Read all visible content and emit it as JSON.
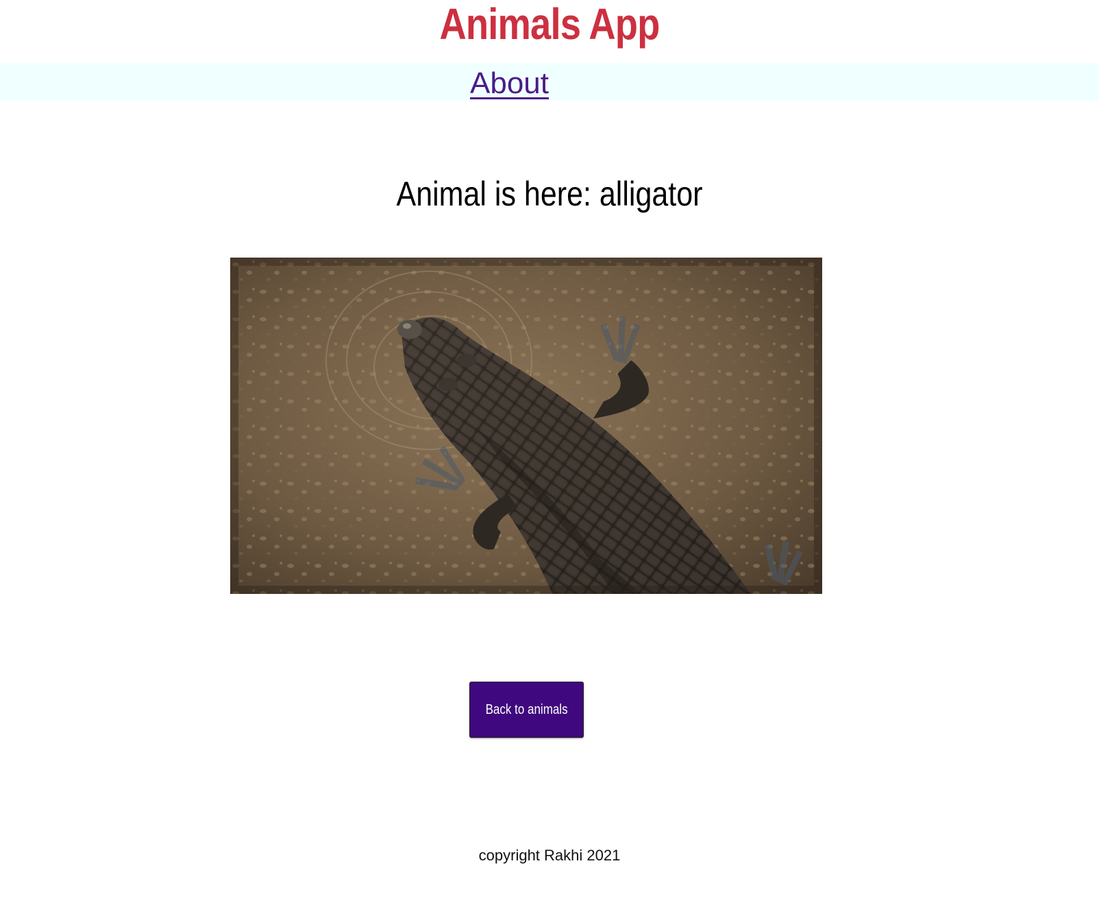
{
  "header": {
    "title": "Animals App",
    "title_color": "#cc3040"
  },
  "nav": {
    "about_label": "About",
    "background": "#f0ffff",
    "link_color": "#4b1c8a"
  },
  "main": {
    "heading": "Animal is here: alligator",
    "image": {
      "subject": "alligator",
      "alt": "alligator"
    },
    "back_button_label": "Back to animals",
    "back_button_color": "#40087e"
  },
  "footer": {
    "copyright": "copyright Rakhi 2021"
  }
}
